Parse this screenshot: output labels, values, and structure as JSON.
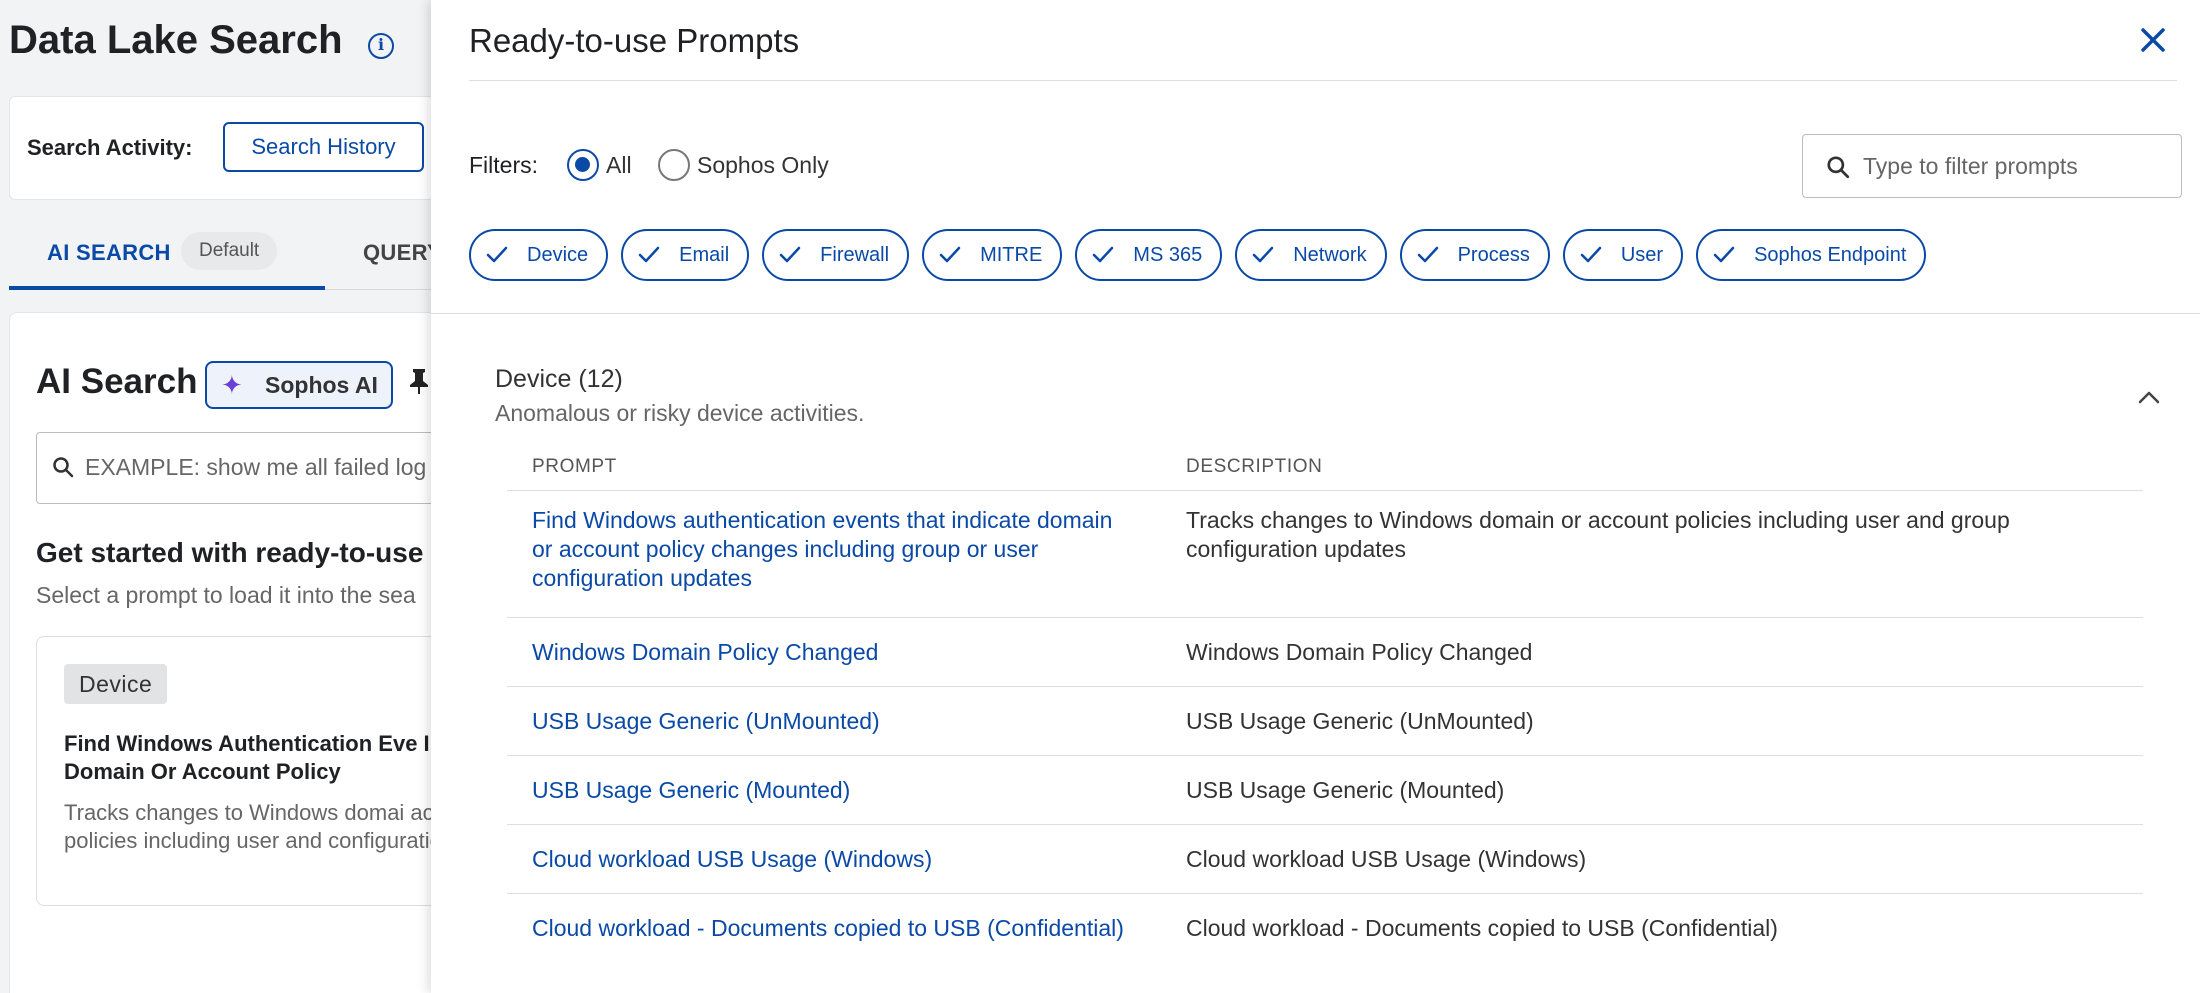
{
  "page": {
    "title": "Data Lake Search",
    "search_activity_label": "Search Activity:",
    "search_history_button": "Search History",
    "tabs": [
      {
        "label": "AI SEARCH",
        "badge": "Default",
        "active": true
      },
      {
        "label": "QUERY"
      }
    ],
    "ai_search": {
      "heading": "AI Search",
      "badge": "Sophos AI",
      "input_placeholder": "EXAMPLE: show me all failed log",
      "get_started": "Get started with ready-to-use p",
      "select_prompt": "Select a prompt to load it into the sea"
    },
    "device_card": {
      "tag": "Device",
      "title": "Find Windows Authentication Eve Indicate Domain Or Account Policy",
      "description": "Tracks changes to Windows domai account policies including user and configuration updates"
    }
  },
  "drawer": {
    "title": "Ready-to-use Prompts",
    "filters_label": "Filters:",
    "radio_options": [
      {
        "label": "All",
        "checked": true
      },
      {
        "label": "Sophos Only",
        "checked": false
      }
    ],
    "filter_placeholder": "Type to filter prompts",
    "chips": [
      "Device",
      "Email",
      "Firewall",
      "MITRE",
      "MS 365",
      "Network",
      "Process",
      "User",
      "Sophos Endpoint"
    ],
    "section": {
      "title": "Device (12)",
      "subtitle": "Anomalous or risky device activities.",
      "columns": {
        "prompt": "PROMPT",
        "description": "DESCRIPTION"
      },
      "rows": [
        {
          "prompt": "Find Windows authentication events that indicate domain or account policy changes including group or user configuration updates",
          "description": "Tracks changes to Windows domain or account policies including user and group configuration updates"
        },
        {
          "prompt": "Windows Domain Policy Changed",
          "description": "Windows Domain Policy Changed"
        },
        {
          "prompt": "USB Usage Generic (UnMounted)",
          "description": "USB Usage Generic (UnMounted)"
        },
        {
          "prompt": "USB Usage Generic (Mounted)",
          "description": "USB Usage Generic (Mounted)"
        },
        {
          "prompt": "Cloud workload USB Usage (Windows)",
          "description": "Cloud workload USB Usage (Windows)"
        },
        {
          "prompt": "Cloud workload - Documents copied to USB (Confidential)",
          "description": "Cloud workload - Documents copied to USB (Confidential)"
        }
      ]
    }
  },
  "colors": {
    "accent": "#0a4aa6",
    "text": "#202124",
    "muted": "#666666",
    "border": "#dcdee1",
    "ai_sparkle": "#6a3fd9"
  },
  "icons": {
    "info": "info-icon",
    "pin": "pin-icon",
    "search": "search-icon",
    "close": "close-icon",
    "check": "check-icon",
    "collapse": "chevron-up-icon",
    "sparkle": "sparkle-icon"
  }
}
